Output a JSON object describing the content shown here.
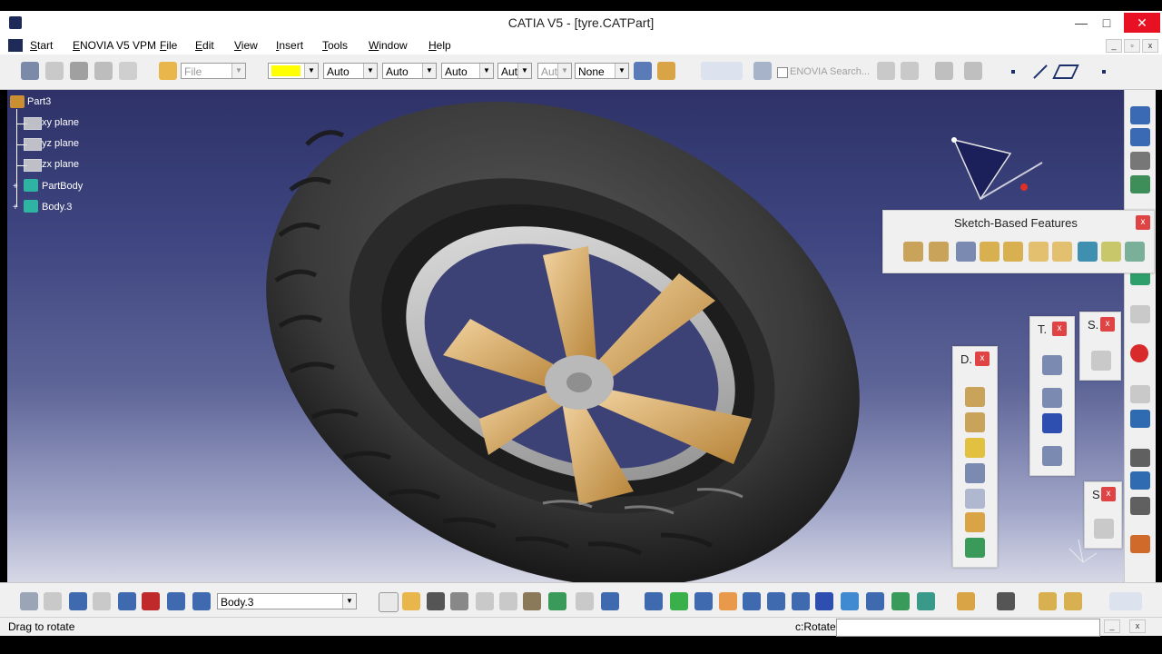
{
  "window": {
    "title": "CATIA V5 - [tyre.CATPart]",
    "minimize": "—",
    "maximize": "□",
    "close": "✕"
  },
  "menu": {
    "items": [
      "Start",
      "ENOVIA V5 VPM",
      "File",
      "Edit",
      "View",
      "Insert",
      "Tools",
      "Window",
      "Help"
    ]
  },
  "toolbar": {
    "file_combo": "File",
    "color_combo": "",
    "line_auto_1": "Auto",
    "line_auto_2": "Auto",
    "line_auto_3": "Auto",
    "layer_combo": "Aut",
    "layer_combo_disabled": "Aut",
    "render_combo": "None",
    "enovia_search": "ENOVIA Search..."
  },
  "tree": {
    "root": "Part3",
    "items": [
      "xy plane",
      "yz plane",
      "zx plane",
      "PartBody",
      "Body.3"
    ]
  },
  "panels": {
    "sketch_based": {
      "title": "Sketch-Based Features",
      "close": "x"
    },
    "dress_up": {
      "title": "D.",
      "close": "x"
    },
    "transform": {
      "title": "T.",
      "close": "x"
    },
    "surface_based": {
      "title": "S.",
      "close": "x"
    },
    "sketcher": {
      "title": "S.",
      "close": "x"
    }
  },
  "bottom_toolbar": {
    "body_combo": "Body.3"
  },
  "status": {
    "message": "Drag to rotate",
    "command_label": "c:Rotate",
    "command_value": ""
  },
  "colors": {
    "viewport_top": "#2e3268",
    "viewport_bottom": "#d7d8e6",
    "tyre": "#3a3a3a",
    "rim": "#c9c9c9",
    "hub_gold": "#d7a85a",
    "close_red": "#e04343"
  },
  "icons": {
    "compass": "compass-icon",
    "axis": "axis-icon"
  }
}
